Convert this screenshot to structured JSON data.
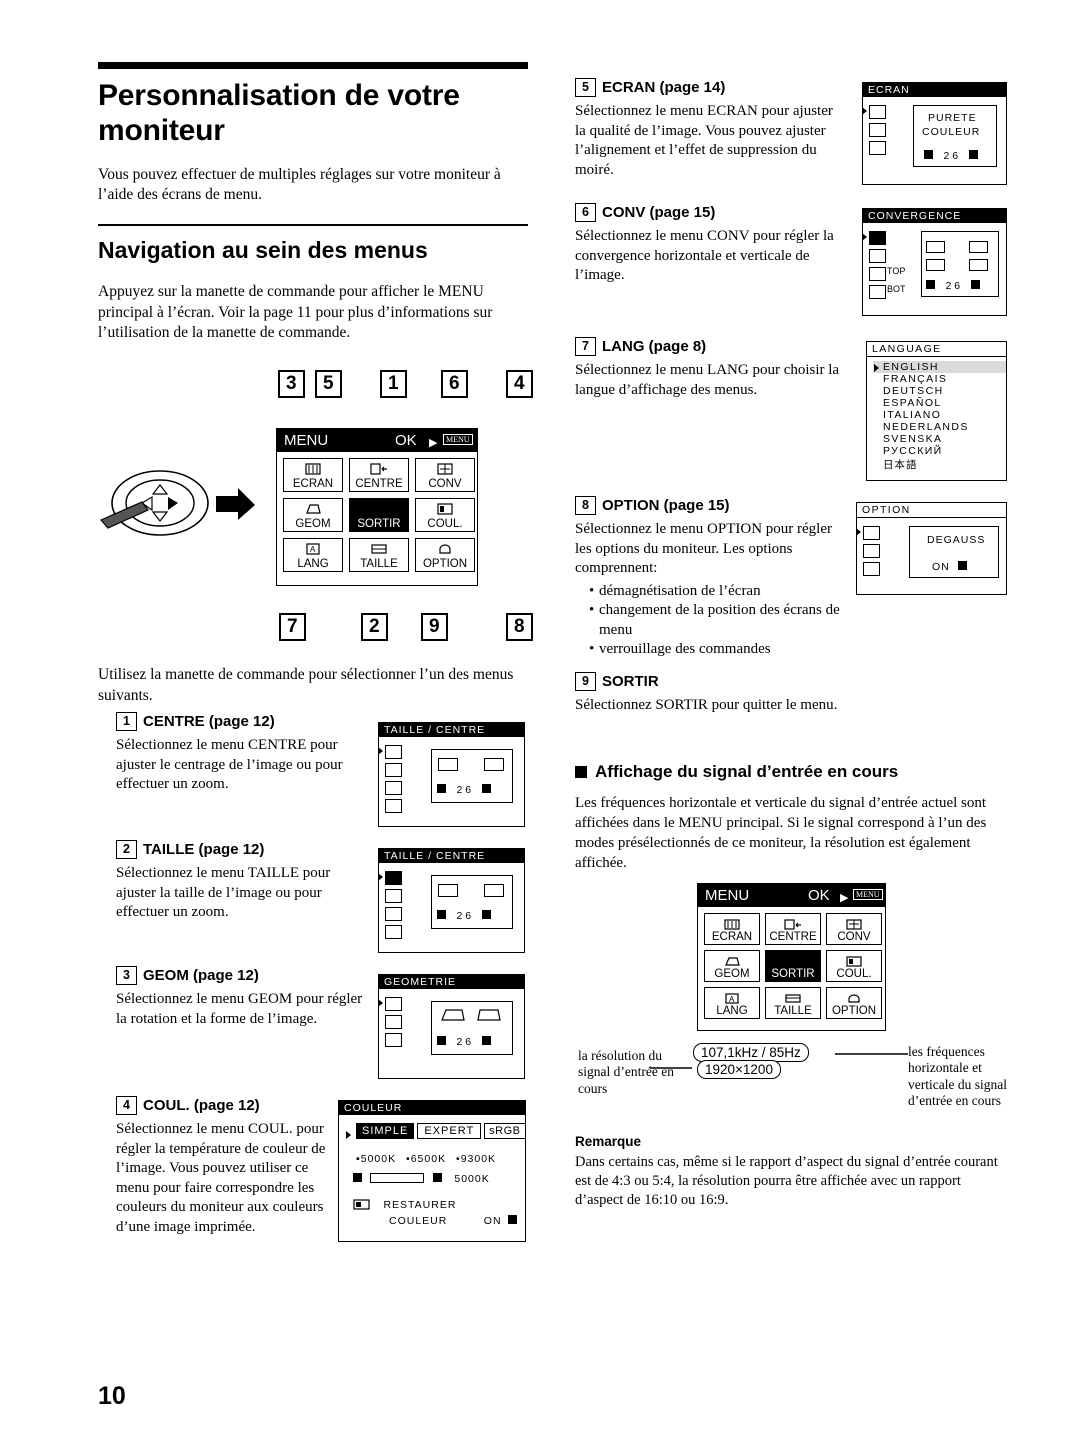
{
  "page_number": "10",
  "title": "Personnalisation de votre moniteur",
  "intro": "Vous pouvez effectuer de multiples réglages sur votre moniteur à l’aide des écrans de menu.",
  "section_nav": {
    "heading": "Navigation au sein des menus",
    "paragraph": "Appuyez sur la manette de commande pour afficher le MENU principal à l’écran. Voir la page 11 pour plus d’informations sur l’utilisation de la manette de commande.",
    "after_figure": "Utilisez la manette de commande pour sélectionner l’un des menus suivants."
  },
  "menu_map": {
    "top_numbers": [
      "3",
      "5",
      "1",
      "6",
      "4"
    ],
    "bottom_numbers": [
      "7",
      "2",
      "9",
      "8"
    ],
    "header_menu": "MENU",
    "header_ok": "OK",
    "header_badge": "MENU",
    "cells": [
      {
        "label": "ECRAN",
        "selected": false
      },
      {
        "label": "CENTRE",
        "selected": false
      },
      {
        "label": "CONV",
        "selected": false
      },
      {
        "label": "GEOM",
        "selected": false
      },
      {
        "label": "SORTIR",
        "selected": true
      },
      {
        "label": "COUL.",
        "selected": false
      },
      {
        "label": "LANG",
        "selected": false
      },
      {
        "label": "TAILLE",
        "selected": false
      },
      {
        "label": "OPTION",
        "selected": false
      }
    ]
  },
  "steps": [
    {
      "num": "1",
      "title": "CENTRE (page 12)",
      "body": "Sélectionnez le menu CENTRE pour ajuster le centrage de l’image ou pour effectuer un zoom.",
      "osd": {
        "title": "TAILLE / CENTRE",
        "value": "2 6"
      }
    },
    {
      "num": "2",
      "title": "TAILLE (page 12)",
      "body": "Sélectionnez le menu TAILLE pour ajuster la taille de l’image ou pour effectuer un zoom.",
      "osd": {
        "title": "TAILLE / CENTRE",
        "value": "2 6"
      }
    },
    {
      "num": "3",
      "title": "GEOM (page 12)",
      "body": "Sélectionnez le menu GEOM pour régler la rotation et la forme de l’image.",
      "osd": {
        "title": "GEOMETRIE",
        "value": "2 6"
      }
    },
    {
      "num": "4",
      "title": "COUL. (page 12)",
      "body": "Sélectionnez le menu COUL. pour régler la température de couleur de l’image. Vous pouvez utiliser ce menu pour faire correspondre les couleurs du moniteur aux couleurs d’une image imprimée.",
      "osd": {
        "title": "COULEUR",
        "tabs": [
          "SIMPLE",
          "EXPERT",
          "sRGB"
        ],
        "selected_tab": "SIMPLE",
        "presets": [
          "5000K",
          "6500K",
          "9300K"
        ],
        "value": "5000K",
        "restore_label_1": "RESTAURER",
        "restore_label_2": "COULEUR",
        "restore_state": "ON"
      }
    },
    {
      "num": "5",
      "title": "ECRAN (page 14)",
      "body": "Sélectionnez le menu ECRAN pour ajuster la qualité de l’image. Vous pouvez ajuster l’alignement et l’effet de suppression du moiré.",
      "osd": {
        "title": "ECRAN",
        "line1": "PURETE",
        "line2": "COULEUR",
        "value": "2 6"
      }
    },
    {
      "num": "6",
      "title": "CONV (page 15)",
      "body": "Sélectionnez le menu CONV pour régler la convergence horizontale et verticale de l’image.",
      "osd": {
        "title": "CONVERGENCE",
        "top_label": "TOP",
        "bot_label": "BOT",
        "value": "2 6"
      }
    },
    {
      "num": "7",
      "title": "LANG (page 8)",
      "body": "Sélectionnez le menu LANG pour choisir la langue d’affichage des menus.",
      "osd": {
        "title": "LANGUAGE",
        "languages": [
          "ENGLISH",
          "FRANÇAIS",
          "DEUTSCH",
          "ESPAÑOL",
          "ITALIANO",
          "NEDERLANDS",
          "SVENSKA",
          "РУССКИЙ",
          "日本語"
        ],
        "selected": "ENGLISH"
      }
    },
    {
      "num": "8",
      "title": "OPTION (page 15)",
      "body": "Sélectionnez le menu OPTION pour régler les options du moniteur. Les options comprennent:",
      "bullets": [
        "démagnétisation de l’écran",
        "changement de la position des écrans de menu",
        "verrouillage des commandes"
      ],
      "osd": {
        "title": "OPTION",
        "label": "DEGAUSS",
        "state": "ON"
      }
    },
    {
      "num": "9",
      "title": "SORTIR",
      "body": "Sélectionnez SORTIR pour quitter le menu.",
      "osd": null
    }
  ],
  "signal_section": {
    "heading": "Affichage du signal d’entrée en cours",
    "paragraph": "Les fréquences horizontale et verticale du signal d’entrée actuel sont affichées dans le MENU principal. Si le signal correspond à l’un des modes présélectionnés de ce moniteur, la résolution est également affichée.",
    "menu_header_menu": "MENU",
    "menu_header_ok": "OK",
    "menu_header_badge": "MENU",
    "frequency": "107,1kHz /   85Hz",
    "resolution": "1920×1200",
    "callout_left": "la résolution du signal d’entrée en cours",
    "callout_right": "les fréquences horizontale et verticale du signal d’entrée en cours",
    "remark_title": "Remarque",
    "remark_body": "Dans certains cas, même si le rapport d’aspect du signal d’entrée courant est de 4:3 ou 5:4, la résolution pourra être affichée avec un rapport d’aspect de 16:10 ou 16:9."
  }
}
